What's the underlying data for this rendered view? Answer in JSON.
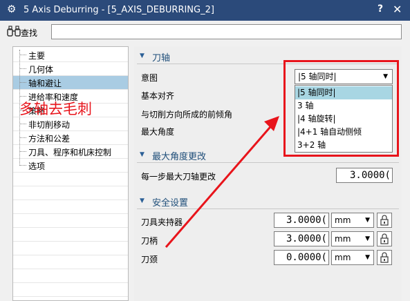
{
  "window": {
    "title": "5 Axis Deburring - [5_AXIS_DEBURRING_2]",
    "help": "?",
    "close": "✕"
  },
  "find": {
    "label": "查找",
    "value": ""
  },
  "tree": {
    "items": [
      {
        "label": "主要",
        "selected": false
      },
      {
        "label": "几何体",
        "selected": false
      },
      {
        "label": "轴和避让",
        "selected": true
      },
      {
        "label": "进给率和速度",
        "selected": false
      },
      {
        "label": "策略",
        "selected": false
      },
      {
        "label": "非切削移动",
        "selected": false
      },
      {
        "label": "方法和公差",
        "selected": false
      },
      {
        "label": "刀具、程序和机床控制",
        "selected": false
      },
      {
        "label": "选项",
        "selected": false
      }
    ]
  },
  "tool_axis": {
    "title": "刀轴",
    "intent_label": "意图",
    "basic_align_label": "基本对齐",
    "lead_angle_label": "与切削方向所成的前倾角",
    "max_angle_label": "最大角度",
    "intent_value": "|5 轴同时|",
    "options": [
      "|5 轴同时|",
      "3 轴",
      "|4 轴旋转|",
      "|4+1 轴自动侧倾",
      "3+2 轴"
    ],
    "highlighted_index": 0
  },
  "max_angle_change": {
    "title": "最大角度更改",
    "per_step_label": "每一步最大刀轴更改",
    "per_step_value": "3.0000("
  },
  "safety": {
    "title": "安全设置",
    "rows": [
      {
        "label": "刀具夹持器",
        "value": "3.0000(",
        "unit": "mm"
      },
      {
        "label": "刀柄",
        "value": "3.0000(",
        "unit": "mm"
      },
      {
        "label": "刀颈",
        "value": "0.0000(",
        "unit": "mm"
      }
    ]
  },
  "annotation": {
    "text": "多轴去毛刺",
    "color": "#e8141b"
  },
  "icons": {
    "settings": "gear-icon",
    "find": "binoculars-icon",
    "expand": "triangle-down-icon",
    "dropdown": "chevron-down-icon",
    "lock": "lock-icon"
  }
}
